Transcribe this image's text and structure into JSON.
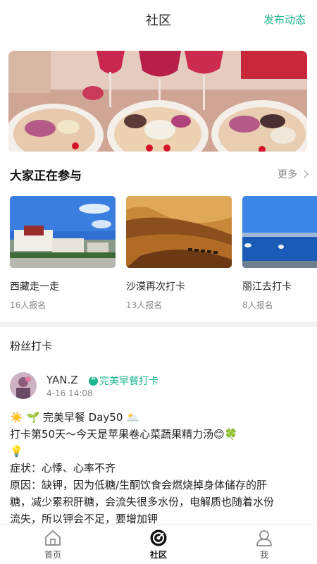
{
  "header": {
    "title": "社区",
    "publish_label": "发布动态"
  },
  "banner": {
    "icon": "breakfast-food-photo"
  },
  "participating": {
    "title": "大家正在参与",
    "more_label": "更多",
    "cards": [
      {
        "name": "西藏走一走",
        "count": "16人报名",
        "image": "potala-palace-photo"
      },
      {
        "name": "沙漠再次打卡",
        "count": "13人报名",
        "image": "desert-camels-photo"
      },
      {
        "name": "丽江去打卡",
        "count": "8人报名",
        "image": "lake-sky-photo"
      }
    ]
  },
  "fans": {
    "title": "粉丝打卡",
    "post": {
      "username": "YAN.Z",
      "time": "4-16 14:08",
      "tag": "完美早餐打卡",
      "lines": [
        "☀️ 🌱 完美早餐 Day50 🌥️",
        "打卡第50天～今天是苹果卷心菜蔬果精力汤😊🍀",
        "",
        "💡",
        "症状：心悸、心率不齐",
        "原因：缺钾，因为低糖/生酮饮食会燃烧掉身体储存的肝",
        "糖，减少累积肝糖，会流失很多水份，电解质也随着水份",
        "流失，所以钾会不足，要增加钾"
      ]
    }
  },
  "tabbar": {
    "items": [
      {
        "label": "首页",
        "icon": "home-icon"
      },
      {
        "label": "社区",
        "icon": "community-icon"
      },
      {
        "label": "我",
        "icon": "profile-icon"
      }
    ],
    "active": 1
  },
  "colors": {
    "accent": "#1fb58f",
    "text": "#222222",
    "muted": "#888888"
  }
}
